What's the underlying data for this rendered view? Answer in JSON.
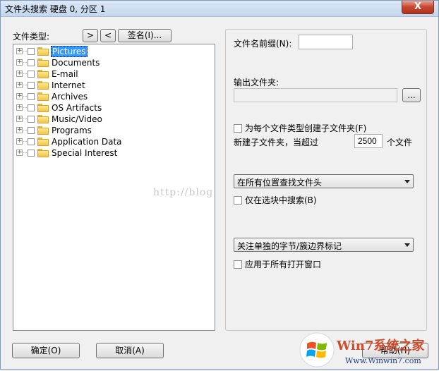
{
  "window": {
    "title": "文件头搜索 硬盘 0, 分区 1",
    "close_glyph": "X"
  },
  "left": {
    "file_types_label": "文件类型:",
    "next_button": ">",
    "prev_button": "<",
    "signature_button": "签名(I)...",
    "tree_items": [
      {
        "label": "Pictures",
        "selected": true
      },
      {
        "label": "Documents"
      },
      {
        "label": "E-mail"
      },
      {
        "label": "Internet"
      },
      {
        "label": "Archives"
      },
      {
        "label": "OS Artifacts"
      },
      {
        "label": "Music/Video"
      },
      {
        "label": "Programs"
      },
      {
        "label": "Application Data"
      },
      {
        "label": "Special Interest"
      }
    ],
    "expand_glyph": "+"
  },
  "right": {
    "filename_prefix_label": "文件名前缀(N):",
    "filename_prefix_value": "",
    "output_folder_label": "输出文件夹:",
    "output_folder_value": "",
    "browse_button": "...",
    "subfolder_checkbox_label": "为每个文件类型创建子文件夹(F)",
    "new_subfolder_label": "新建子文件夹，当超过",
    "threshold_value": "2500",
    "files_unit": "个文件",
    "search_location_select": "在所有位置查找文件头",
    "selection_only_checkbox": "仅在选块中搜索(B)",
    "byte_focus_select": "关注单独的字节/簇边界标记",
    "apply_all_windows_checkbox": "应用于所有打开窗口"
  },
  "footer": {
    "ok_button": "确定(O)",
    "cancel_button": "取消(A)",
    "help_button": "帮助(H)"
  },
  "overlay": {
    "watermark_text": "http://blog",
    "logo_text": "Win7系统之家",
    "logo_url": "Www.Winwin7.com"
  },
  "colors": {
    "selection": "#3399ff",
    "folder": "#f3c74a",
    "close": "#c7452f"
  }
}
